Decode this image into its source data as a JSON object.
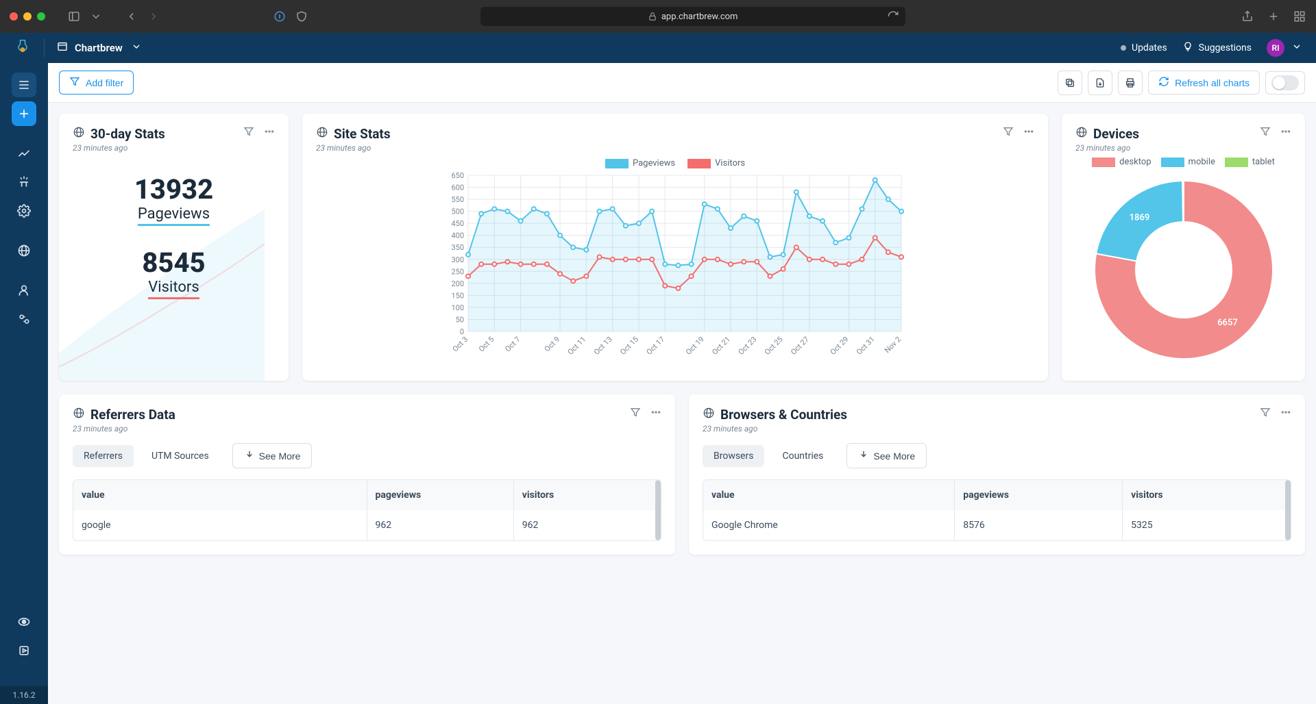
{
  "browser": {
    "url": "app.chartbrew.com"
  },
  "appbar": {
    "team": "Chartbrew",
    "updates": "Updates",
    "suggestions": "Suggestions",
    "avatar": "RI"
  },
  "sidebar": {
    "version": "1.16.2"
  },
  "toolbar": {
    "add_filter": "Add filter",
    "refresh": "Refresh all charts"
  },
  "cards": {
    "stats30": {
      "title": "30-day Stats",
      "updated": "23 minutes ago",
      "pv_value": "13932",
      "pv_label": "Pageviews",
      "vi_value": "8545",
      "vi_label": "Visitors"
    },
    "sitestats": {
      "title": "Site Stats",
      "updated": "23 minutes ago",
      "legend_pv": "Pageviews",
      "legend_vi": "Visitors"
    },
    "devices": {
      "title": "Devices",
      "updated": "23 minutes ago",
      "legend_desktop": "desktop",
      "legend_mobile": "mobile",
      "legend_tablet": "tablet",
      "val_desktop": "6657",
      "val_mobile": "1869"
    },
    "referrers": {
      "title": "Referrers Data",
      "updated": "23 minutes ago",
      "tab_referrers": "Referrers",
      "tab_utm": "UTM Sources",
      "see_more": "See More",
      "col_value": "value",
      "col_pv": "pageviews",
      "col_vi": "visitors",
      "rows": [
        {
          "value": "google",
          "pv": "962",
          "vi": "962"
        }
      ]
    },
    "browsers": {
      "title": "Browsers & Countries",
      "updated": "23 minutes ago",
      "tab_browsers": "Browsers",
      "tab_countries": "Countries",
      "see_more": "See More",
      "col_value": "value",
      "col_pv": "pageviews",
      "col_vi": "visitors",
      "rows": [
        {
          "value": "Google Chrome",
          "pv": "8576",
          "vi": "5325"
        }
      ]
    }
  },
  "chart_data": [
    {
      "type": "line",
      "title": "Site Stats",
      "xlabel": "",
      "ylabel": "",
      "ylim": [
        0,
        650
      ],
      "categories": [
        "Oct 3",
        "Oct 5",
        "Oct 7",
        "Oct 9",
        "Oct 11",
        "Oct 13",
        "Oct 15",
        "Oct 17",
        "Oct 19",
        "Oct 21",
        "Oct 23",
        "Oct 25",
        "Oct 27",
        "Oct 29",
        "Oct 31",
        "Nov 2"
      ],
      "series": [
        {
          "name": "Pageviews",
          "color": "#51c4e8",
          "values": [
            320,
            490,
            510,
            500,
            460,
            510,
            490,
            400,
            350,
            340,
            500,
            510,
            440,
            450,
            500,
            280,
            275,
            280,
            530,
            510,
            430,
            480,
            460,
            310,
            320,
            580,
            480,
            460,
            370,
            390,
            510,
            630,
            550,
            500
          ]
        },
        {
          "name": "Visitors",
          "color": "#f36d6d",
          "values": [
            230,
            280,
            280,
            290,
            280,
            280,
            280,
            240,
            210,
            230,
            310,
            300,
            300,
            300,
            300,
            190,
            180,
            230,
            300,
            300,
            280,
            290,
            290,
            230,
            260,
            350,
            300,
            300,
            280,
            280,
            300,
            390,
            330,
            310
          ]
        }
      ]
    },
    {
      "type": "pie",
      "title": "Devices",
      "series": [
        {
          "name": "desktop",
          "value": 6657,
          "color": "#f28b8b"
        },
        {
          "name": "mobile",
          "value": 1869,
          "color": "#52c5e9"
        },
        {
          "name": "tablet",
          "value": 19,
          "color": "#9bdc6a"
        }
      ]
    }
  ]
}
